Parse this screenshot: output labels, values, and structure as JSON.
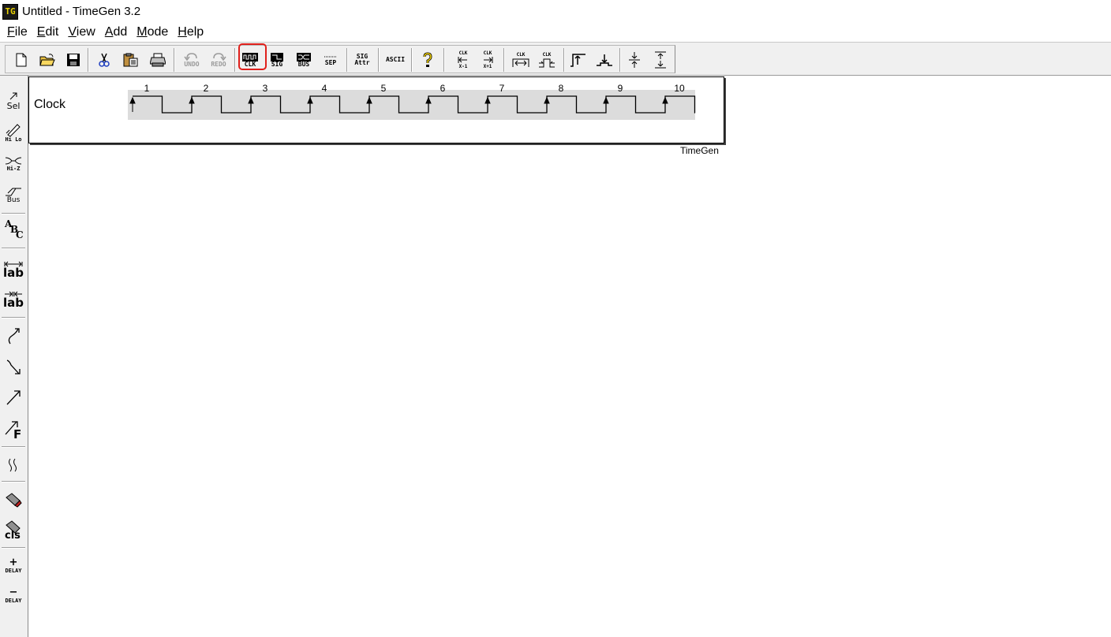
{
  "window": {
    "title": "Untitled - TimeGen 3.2",
    "app_icon_text": "TG"
  },
  "menu": [
    "File",
    "Edit",
    "View",
    "Add",
    "Mode",
    "Help"
  ],
  "toolbar": {
    "undo_label": "UNDO",
    "redo_label": "REDO",
    "clk_label": "CLK",
    "sig_label": "SIG",
    "bus_label": "BUS",
    "sep_label": "SEP",
    "sig_attr_top": "SIG",
    "sig_attr_bottom": "Attr",
    "ascii_label": "ASCII",
    "clk_minus_top": "CLK",
    "clk_minus_bottom": "X-1",
    "clk_plus_top": "CLK",
    "clk_plus_bottom": "X+1",
    "clk_a": "CLK",
    "clk_b": "CLK"
  },
  "sidebar": {
    "sel": "Sel",
    "hilo": "Hi Lo",
    "hiz": "Hi-Z",
    "bus": "Bus",
    "abc_a": "A",
    "abc_b": "B",
    "abc_c": "C",
    "lab1": "lab",
    "lab2": "lab",
    "f_label": "F",
    "cls": "cls",
    "delay_plus": "DELAY",
    "delay_minus": "DELAY"
  },
  "diagram": {
    "signal_name": "Clock",
    "watermark": "TimeGen",
    "cycle_labels": [
      "1",
      "2",
      "3",
      "4",
      "5",
      "6",
      "7",
      "8",
      "9",
      "10"
    ]
  }
}
